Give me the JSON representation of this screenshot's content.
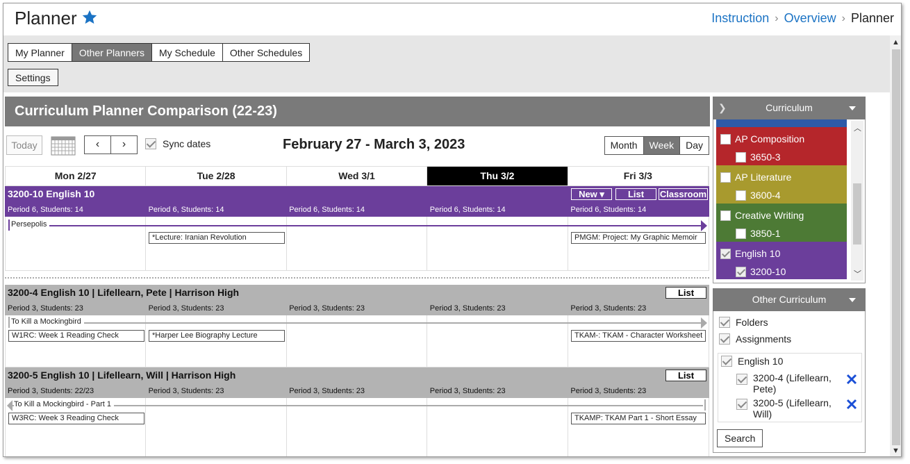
{
  "header": {
    "title": "Planner",
    "breadcrumbs": [
      "Instruction",
      "Overview",
      "Planner"
    ]
  },
  "tabs": [
    "My Planner",
    "Other Planners",
    "My Schedule",
    "Other Schedules"
  ],
  "active_tab": "Other Planners",
  "settings_label": "Settings",
  "main": {
    "title": "Curriculum Planner Comparison (22-23)",
    "today_label": "Today",
    "prev_symbol": "‹",
    "next_symbol": "›",
    "sync_label": "Sync dates",
    "date_range": "February 27 - March 3, 2023",
    "views": [
      "Month",
      "Week",
      "Day"
    ],
    "active_view": "Week",
    "days": [
      "Mon 2/27",
      "Tue 2/28",
      "Wed 3/1",
      "Thu 3/2",
      "Fri 3/3"
    ],
    "today_day": "Thu 3/2"
  },
  "sections": [
    {
      "title": "3200-10 English 10",
      "buttons": [
        "New ▾",
        "List",
        "Classroom"
      ],
      "periods": [
        "Period 6, Students: 14",
        "Period 6, Students: 14",
        "Period 6, Students: 14",
        "Period 6, Students: 14",
        "Period 6, Students: 14"
      ],
      "span_label": "Persepolis",
      "tasks": [
        {
          "day": 1,
          "text": "*Lecture: Iranian Revolution"
        },
        {
          "day": 4,
          "text": "PMGM: Project: My Graphic Memoir"
        }
      ]
    },
    {
      "title": "3200-4 English 10 | Lifellearn, Pete | Harrison High",
      "buttons": [
        "List"
      ],
      "periods": [
        "Period 3, Students: 23",
        "Period 3, Students: 23",
        "Period 3, Students: 23",
        "Period 3, Students: 23",
        "Period 3, Students: 23"
      ],
      "span_label": "To Kill a Mockingbird",
      "tasks": [
        {
          "day": 0,
          "text": "W1RC: Week 1 Reading Check"
        },
        {
          "day": 1,
          "text": "*Harper Lee Biography Lecture"
        },
        {
          "day": 4,
          "text": "TKAM-: TKAM - Character Worksheet"
        }
      ]
    },
    {
      "title": "3200-5 English 10 | Lifellearn, Will | Harrison High",
      "buttons": [
        "List"
      ],
      "periods": [
        "Period 3, Students: 22/23",
        "Period 3, Students: 23",
        "Period 3, Students: 23",
        "Period 3, Students: 23",
        "Period 3, Students: 23"
      ],
      "span_label": "To Kill a Mockingbird - Part 1",
      "tasks": [
        {
          "day": 0,
          "text": "W3RC: Week 3 Reading Check"
        },
        {
          "day": 4,
          "text": "TKAMP: TKAM Part 1 - Short Essay"
        }
      ]
    }
  ],
  "curriculum_panel": {
    "title": "Curriculum",
    "items": [
      {
        "name": "AP Composition",
        "code": "3650-3",
        "color": "#b5262b",
        "checked": false
      },
      {
        "name": "AP Literature",
        "code": "3600-4",
        "color": "#a89a2e",
        "checked": false
      },
      {
        "name": "Creative Writing",
        "code": "3850-1",
        "color": "#4d7a35",
        "checked": false
      },
      {
        "name": "English 10",
        "code": "3200-10",
        "color": "#6b3e9b",
        "checked": true
      }
    ]
  },
  "other_curriculum_panel": {
    "title": "Other Curriculum",
    "folders_label": "Folders",
    "assignments_label": "Assignments",
    "group_label": "English 10",
    "entries": [
      "3200-4 (Lifellearn, Pete)",
      "3200-5 (Lifellearn, Will)"
    ],
    "search_label": "Search"
  },
  "colors": {
    "purple": "#6b3e9b",
    "gray_header": "#7a7a7a",
    "link": "#1b73c4",
    "remove": "#1a4fd6"
  }
}
